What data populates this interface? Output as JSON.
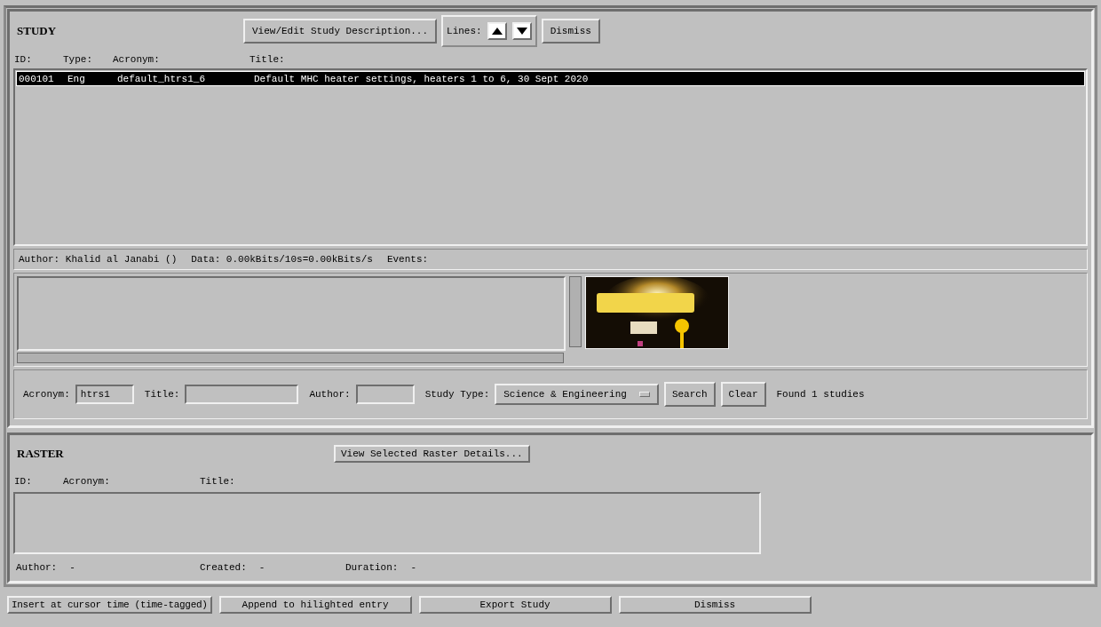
{
  "study": {
    "title": "STUDY",
    "description_button": "View/Edit Study Description...",
    "lines_label": "Lines:",
    "dismiss_button": "Dismiss",
    "columns": [
      "ID:",
      "Type:",
      "Acronym:",
      "Title:"
    ],
    "rows": [
      {
        "id": "000101",
        "type": "Eng",
        "acronym": "default_htrs1_6",
        "title": "Default MHC heater settings, heaters 1 to 6, 30 Sept 2020",
        "selected": true
      }
    ],
    "info": {
      "author": "Author: Khalid al Janabi ()",
      "data": "Data: 0.00kBits/10s=0.00kBits/s",
      "events": "Events:"
    },
    "search": {
      "acronym_label": "Acronym:",
      "acronym_value": "htrs1",
      "title_label": "Title:",
      "author_label": "Author:",
      "type_label": "Study Type:",
      "type_value": "Science & Engineering",
      "search_button": "Search",
      "clear_button": "Clear",
      "status": "Found 1 studies"
    }
  },
  "raster": {
    "title": "RASTER",
    "details_button": "View Selected Raster Details...",
    "columns": [
      "ID:",
      "Acronym:",
      "Title:"
    ],
    "fields": [
      {
        "label": "Author:",
        "value": "-"
      },
      {
        "label": "Created:",
        "value": "-"
      },
      {
        "label": "Duration:",
        "value": "-"
      }
    ]
  },
  "buttons": [
    "Insert at cursor time (time-tagged)",
    "Append to hilighted entry",
    "Export Study",
    "Dismiss"
  ]
}
